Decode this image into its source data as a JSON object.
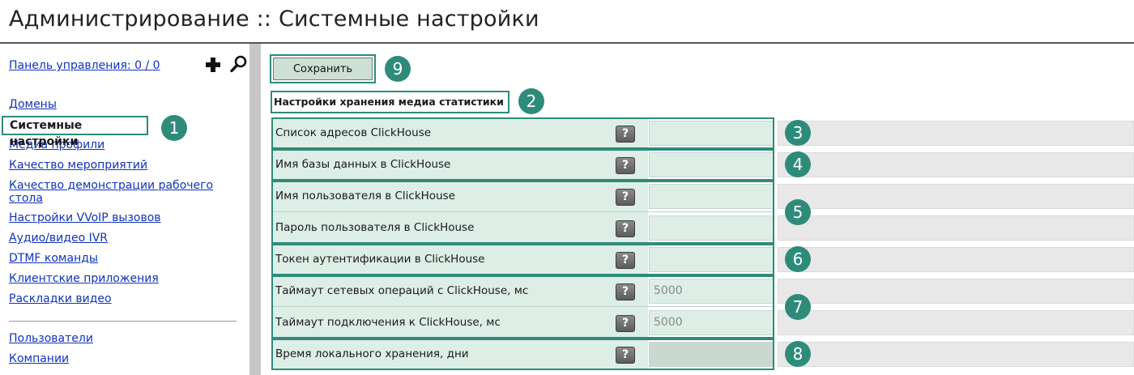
{
  "page": {
    "title": "Администрирование :: Системные настройки"
  },
  "sidebar": {
    "dashboard_link": "Панель управления: 0 / 0",
    "add_icon": "plus-icon",
    "search_icon": "magnifier-icon",
    "nav_main": [
      {
        "label": "Домены"
      },
      {
        "label": "Системные настройки",
        "active": true
      },
      {
        "label": "Медиа профили"
      },
      {
        "label": "Качество мероприятий"
      },
      {
        "label": "Качество демонстрации рабочего стола"
      },
      {
        "label": "Настройки VVoIP вызовов"
      },
      {
        "label": "Аудио/видео IVR"
      },
      {
        "label": "DTMF команды"
      },
      {
        "label": "Клиентские приложения"
      },
      {
        "label": "Раскладки видео"
      }
    ],
    "nav_secondary": [
      {
        "label": "Пользователи"
      },
      {
        "label": "Компании"
      }
    ]
  },
  "toolbar": {
    "save_label": "Сохранить"
  },
  "section": {
    "title": "Настройки хранения медиа статистики"
  },
  "settings": [
    {
      "label": "Список адресов ClickHouse",
      "value": ""
    },
    {
      "label": "Имя базы данных в ClickHouse",
      "value": ""
    },
    {
      "label": "Имя пользователя в ClickHouse",
      "value": ""
    },
    {
      "label": "Пароль пользователя в ClickHouse",
      "value": ""
    },
    {
      "label": "Токен аутентификации в ClickHouse",
      "value": ""
    },
    {
      "label": "Таймаут сетевых операций с ClickHouse, мс",
      "value": "5000"
    },
    {
      "label": "Таймаут подключения к ClickHouse, мс",
      "value": "5000"
    },
    {
      "label": "Время локального хранения, дни",
      "value": ""
    }
  ],
  "help_glyph": "?",
  "badges": [
    "1",
    "2",
    "3",
    "4",
    "5",
    "6",
    "7",
    "8",
    "9"
  ],
  "colors": {
    "accent": "#2e8b7a",
    "link": "#1133bb",
    "row_bg": "#ddeee6",
    "help_bg": "#6e6e6e",
    "separator": "#c7c7c7"
  }
}
